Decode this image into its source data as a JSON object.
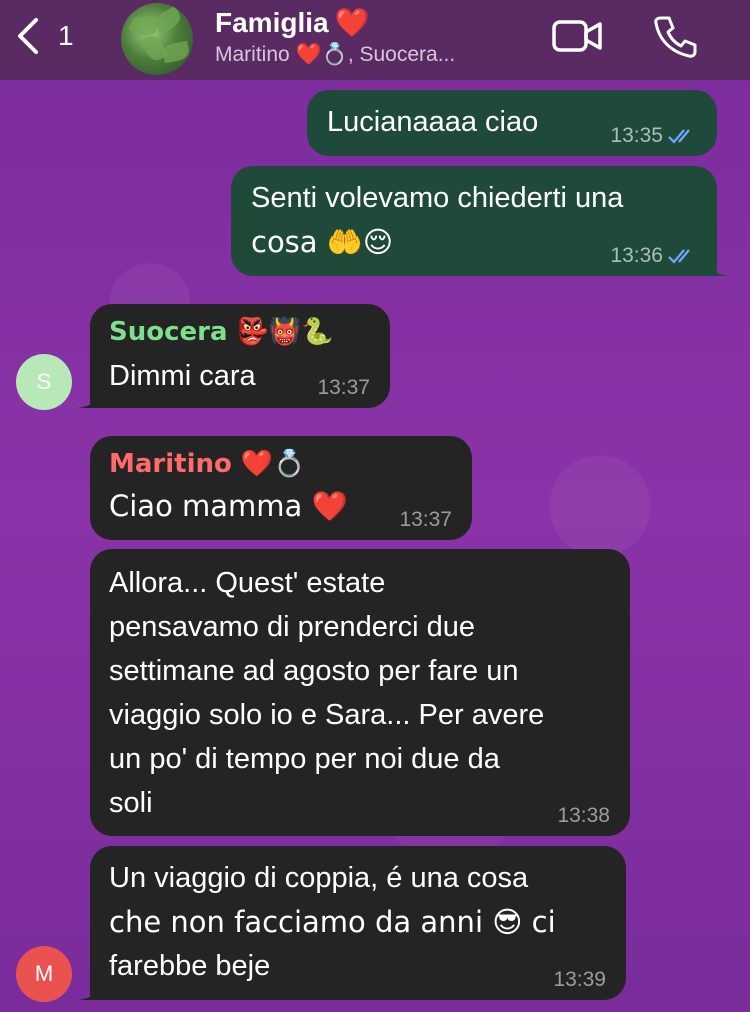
{
  "header": {
    "back_count": "1",
    "title": "Famiglia",
    "title_emoji": "❤️",
    "subtitle": "Maritino ❤️💍, Suocera..."
  },
  "colors": {
    "header_bg": "#5a2a63",
    "wallpaper": "#7d2e9e",
    "outgoing_bubble": "#1f4a3a",
    "incoming_bubble": "#242424",
    "suocera_name": "#7de08a",
    "maritino_name": "#ff6b6b",
    "read_ticks": "#6fa8ff"
  },
  "icons": {
    "back": "chevron-left-icon",
    "video": "video-camera-icon",
    "phone": "phone-icon",
    "read": "double-check-icon"
  },
  "messages": [
    {
      "text": "Lucianaaaa ciao",
      "time": "13:35"
    },
    {
      "text_line1": "Senti volevamo chiederti una",
      "text_line2": "cosa 🤲😌",
      "time": "13:36"
    },
    {
      "sender": "Suocera 👺👹🐍",
      "text": "Dimmi cara",
      "time": "13:37",
      "avatar_letter": "S"
    },
    {
      "sender": "Maritino ❤️💍",
      "text": "Ciao mamma ❤️",
      "time": "13:37"
    },
    {
      "lines": [
        "Allora... Quest' estate",
        "pensavamo di prenderci due",
        "settimane ad agosto per fare un",
        "viaggio solo io e Sara... Per avere",
        "un po' di tempo per noi due da",
        "soli"
      ],
      "time": "13:38"
    },
    {
      "lines": [
        "Un viaggio di coppia, é una cosa",
        "che non facciamo da anni 😎 ci",
        "farebbe beje"
      ],
      "time": "13:39",
      "avatar_letter": "M"
    }
  ]
}
